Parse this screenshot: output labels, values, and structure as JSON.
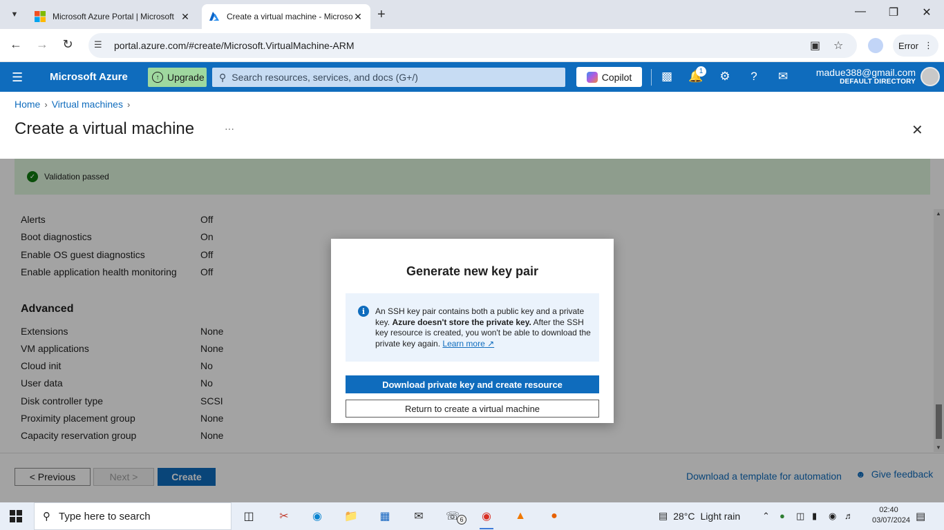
{
  "browser": {
    "tabs": [
      {
        "title": "Microsoft Azure Portal | Microsoft",
        "active": false
      },
      {
        "title": "Create a virtual machine - Microsoft",
        "active": true
      }
    ],
    "url": "portal.azure.com/#create/Microsoft.VirtualMachine-ARM",
    "profile_status": "Error"
  },
  "azure_header": {
    "brand": "Microsoft Azure",
    "upgrade_label": "Upgrade",
    "search_placeholder": "Search resources, services, and docs (G+/)",
    "copilot_label": "Copilot",
    "notification_count": "1",
    "account_email": "madue388@gmail.com",
    "directory": "DEFAULT DIRECTORY"
  },
  "breadcrumb": [
    "Home",
    "Virtual machines"
  ],
  "page": {
    "title": "Create a virtual machine",
    "more_label": "···"
  },
  "validation": {
    "status": "Validation passed"
  },
  "monitoring": [
    {
      "label": "Alerts",
      "value": "Off"
    },
    {
      "label": "Boot diagnostics",
      "value": "On"
    },
    {
      "label": "Enable OS guest diagnostics",
      "value": "Off"
    },
    {
      "label": "Enable application health monitoring",
      "value": "Off"
    }
  ],
  "advanced": {
    "heading": "Advanced",
    "rows": [
      {
        "label": "Extensions",
        "value": "None"
      },
      {
        "label": "VM applications",
        "value": "None"
      },
      {
        "label": "Cloud init",
        "value": "No"
      },
      {
        "label": "User data",
        "value": "No"
      },
      {
        "label": "Disk controller type",
        "value": "SCSI"
      },
      {
        "label": "Proximity placement group",
        "value": "None"
      },
      {
        "label": "Capacity reservation group",
        "value": "None"
      }
    ]
  },
  "footer": {
    "previous_label": "< Previous",
    "next_label": "Next >",
    "create_label": "Create",
    "template_link": "Download a template for automation",
    "feedback_link": "Give feedback"
  },
  "dialog": {
    "title": "Generate new key pair",
    "info_part1": "An SSH key pair contains both a public key and a private key. ",
    "info_bold": "Azure doesn't store the private key.",
    "info_part2": " After the SSH key resource is created, you won't be able to download the private key again. ",
    "info_link": "Learn more",
    "primary_button": "Download private key and create resource",
    "secondary_button": "Return to create a virtual machine"
  },
  "taskbar": {
    "search_placeholder": "Type here to search",
    "whatsapp_badge": "6",
    "temperature": "28°C",
    "weather": "Light rain",
    "time": "02:40",
    "date": "03/07/2024"
  },
  "colors": {
    "azure_blue": "#0f6cbd",
    "success_green": "#107c10",
    "validation_bg": "#dff6dd",
    "upgrade_green": "#9fd89f"
  }
}
